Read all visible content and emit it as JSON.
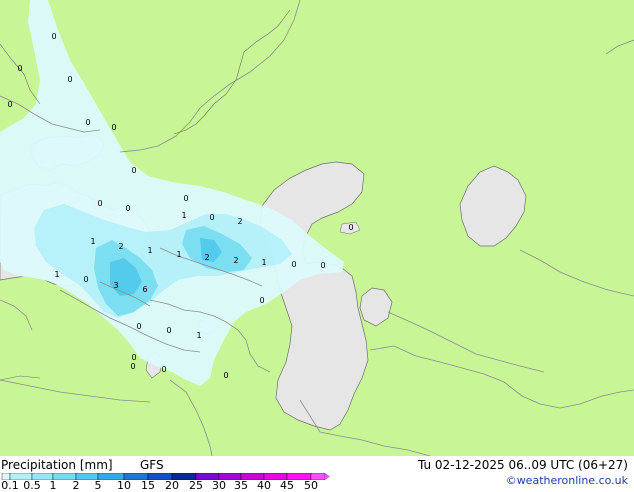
{
  "title": {
    "variable": "Precipitation [mm]",
    "model": "GFS",
    "valid_time": "Tu 02-12-2025 06..09 UTC (06+27)",
    "credit": "©weatheronline.co.uk"
  },
  "legend": {
    "ticks": [
      "0.1",
      "0.5",
      "1",
      "2",
      "5",
      "10",
      "15",
      "20",
      "25",
      "30",
      "35",
      "40",
      "45",
      "50"
    ],
    "colors": [
      "#dcfafc",
      "#b4f0fa",
      "#96e6f5",
      "#78dcf0",
      "#50c8eb",
      "#32aae6",
      "#1e78d2",
      "#1450c3",
      "#0a2896",
      "#780ad2",
      "#a00ad7",
      "#c80ad7",
      "#e60ae1",
      "#fa14f0",
      "#fa50fa"
    ]
  },
  "map_colors": {
    "land": "#c8f596",
    "sea": "#e6e6e6",
    "border": "#8c8c8c",
    "coast": "#6e6e6e"
  },
  "precip_values": [
    "0",
    "0",
    "0",
    "0",
    "0",
    "0",
    "0",
    "0",
    "1",
    "0",
    "2",
    "0",
    "1",
    "2",
    "1",
    "1",
    "2",
    "2",
    "1",
    "0",
    "0",
    "1",
    "0",
    "3",
    "6",
    "0",
    "0",
    "0",
    "0",
    "1",
    "0",
    "0",
    "0",
    "0",
    "0"
  ]
}
